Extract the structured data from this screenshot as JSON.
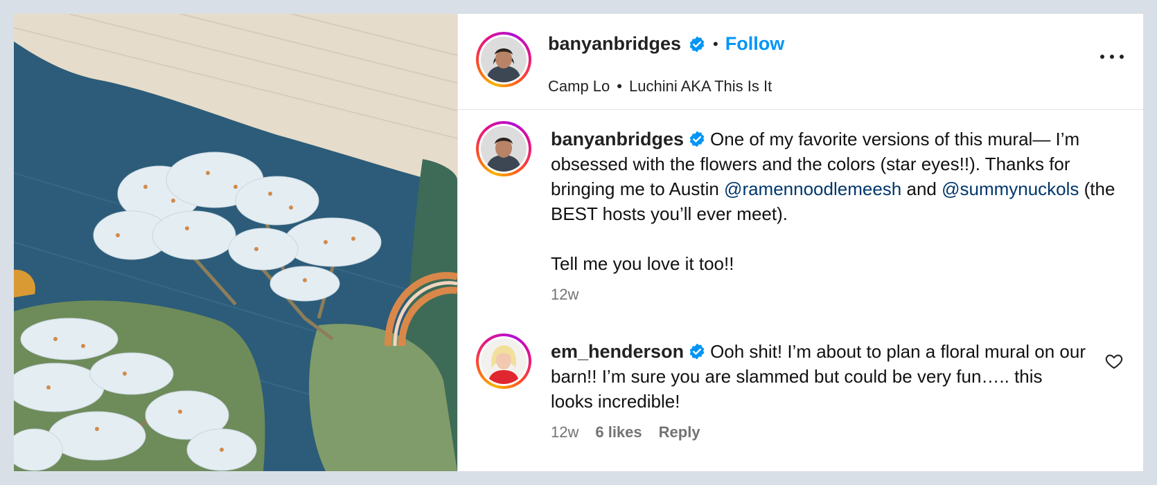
{
  "post": {
    "author": "banyanbridges",
    "follow_label": "Follow",
    "separator": "•",
    "audio_artist": "Camp Lo",
    "audio_track": "Luchini AKA This Is It"
  },
  "caption": {
    "username": "banyanbridges",
    "text_1": "One of my favorite versions of this mural— I’m obsessed with the flowers and the colors (star eyes!!). Thanks for bringing me to Austin ",
    "mention_1": "@ramennoodlemeesh",
    "text_2": " and ",
    "mention_2": "@summynuckols",
    "text_3": " (the BEST hosts you’ll ever meet).",
    "text_4": "Tell me you love it too!!",
    "time": "12w"
  },
  "comments": [
    {
      "username": "em_henderson",
      "text": "Ooh shit! I’m about to plan a floral mural on our barn!! I’m sure you are slammed but could be very fun….. this looks incredible!",
      "time": "12w",
      "likes": "6 likes",
      "reply_label": "Reply"
    }
  ],
  "colors": {
    "follow": "#0095f6",
    "mention": "#00376b",
    "verified": "#0095f6",
    "background": "#d9dfe7"
  }
}
